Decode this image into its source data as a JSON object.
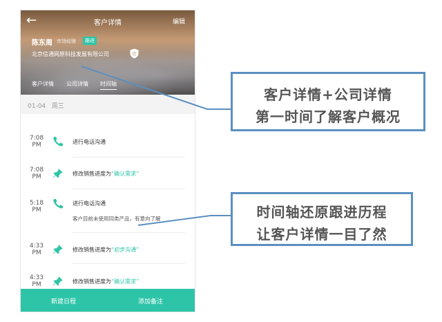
{
  "header": {
    "title": "客户详情",
    "edit_label": "编辑",
    "back_icon": "arrow-left-icon"
  },
  "customer": {
    "name": "陈东周",
    "role": "市场经理",
    "badge": "跟进",
    "company": "北京信通网原科技发展有限公司",
    "shield_char": "信"
  },
  "tabs": [
    {
      "label": "客户详情"
    },
    {
      "label": "公司详情"
    },
    {
      "label": "时间轴",
      "active": true
    }
  ],
  "date_row": {
    "date": "01-04",
    "weekday": "周三"
  },
  "timeline": [
    {
      "time": "7:08",
      "ampm": "PM",
      "icon": "phone-icon",
      "text": "进行电话沟通"
    },
    {
      "time": "7:08",
      "ampm": "PM",
      "icon": "pin-icon",
      "text": "修改销售进度为",
      "highlight": "“确认需求”"
    },
    {
      "time": "5:18",
      "ampm": "PM",
      "icon": "phone-icon",
      "text": "进行电话沟通",
      "detail": "客户目前未使用同类产品，有意向了解"
    },
    {
      "time": "4:33",
      "ampm": "PM",
      "icon": "pin-icon",
      "text": "修改销售进度为",
      "highlight": "“初步沟通”"
    },
    {
      "time": "4:33",
      "ampm": "PM",
      "icon": "pin-icon",
      "text": "修改销售进度为",
      "highlight": "“确认需求”"
    }
  ],
  "bottom_bar": {
    "new_schedule": "新建日程",
    "add_note": "添加备注"
  },
  "callouts": [
    {
      "line1": "客户详情+公司详情",
      "line2": "第一时间了解客户概况"
    },
    {
      "line1": "时间轴还原跟进历程",
      "line2": "让客户详情一目了然"
    }
  ],
  "colors": {
    "accent": "#2ec4a8",
    "callout_border": "#5a8fc0"
  }
}
